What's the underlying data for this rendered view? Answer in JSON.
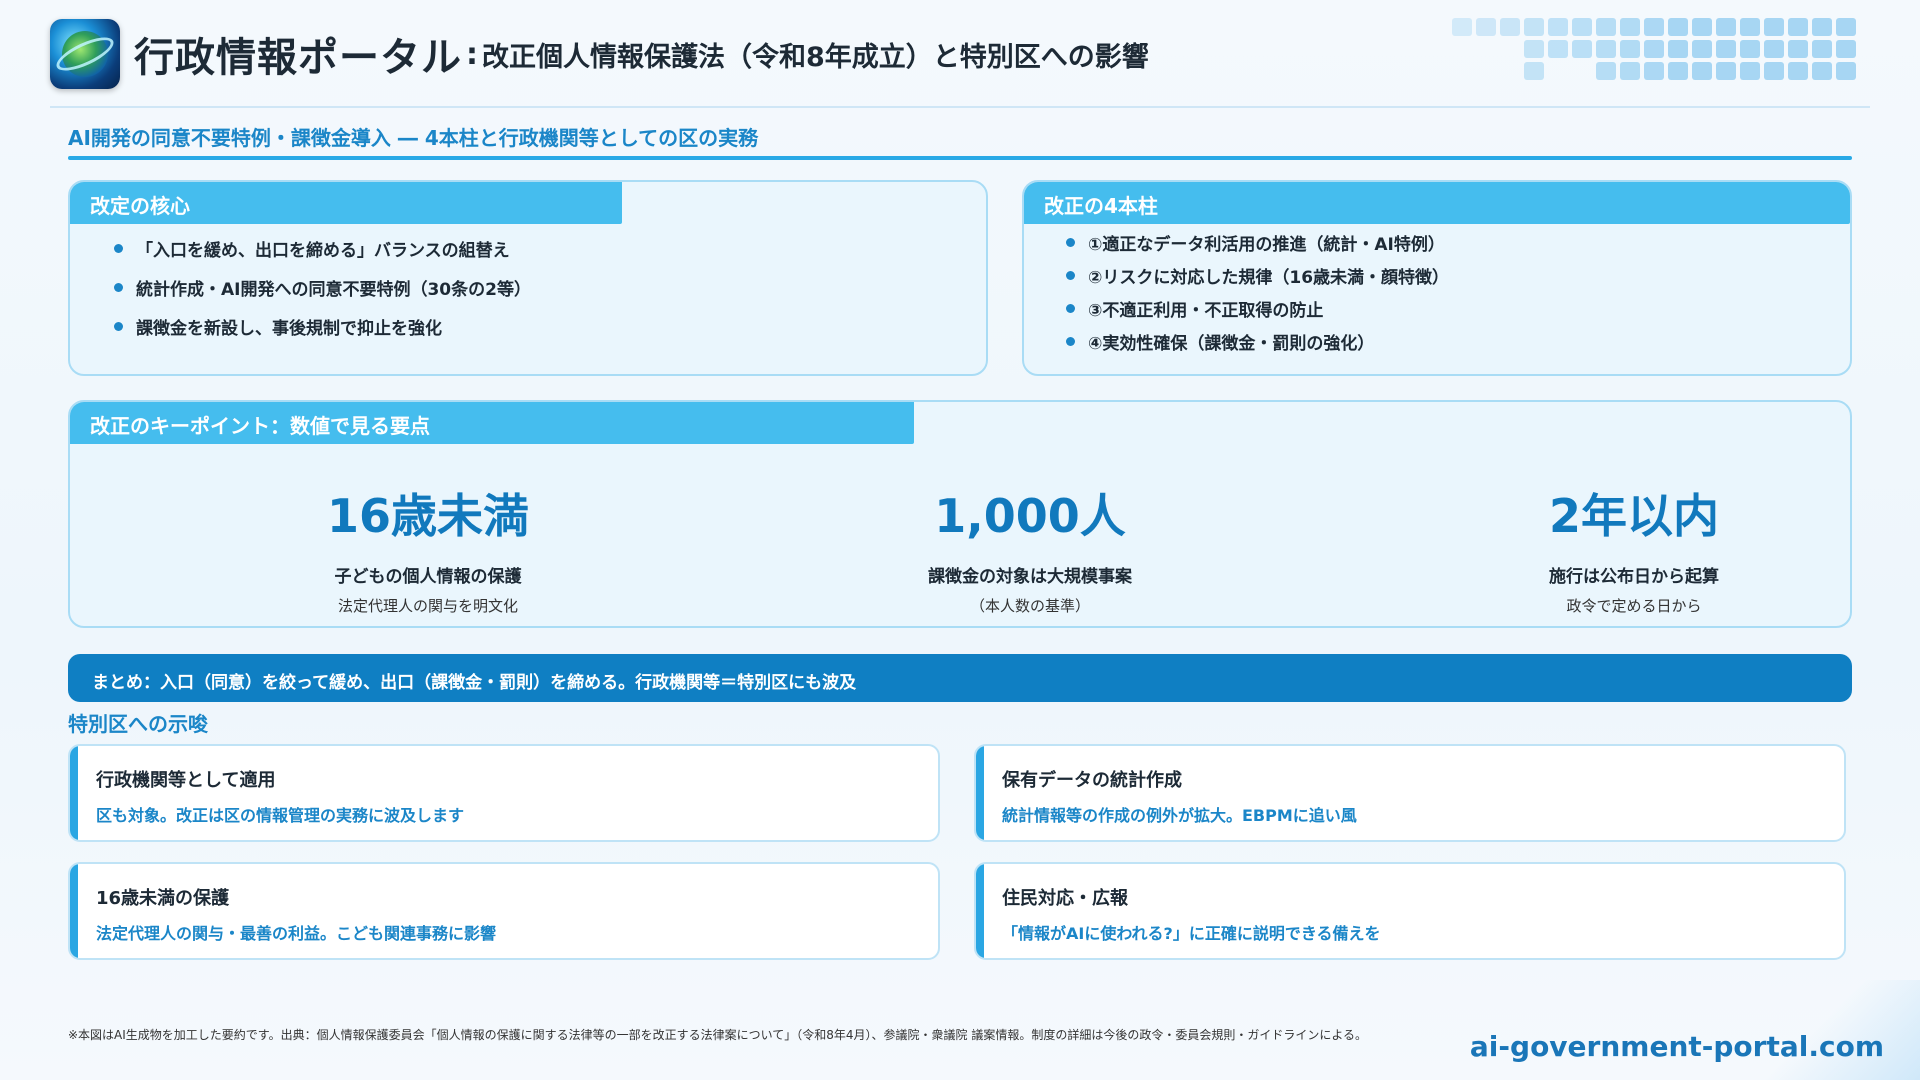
{
  "header": {
    "title": "行政情報ポータル",
    "separator": ":",
    "subtitle": "改正個人情報保護法（令和8年成立）と特別区への影響"
  },
  "subheading": "AI開発の同意不要特例・課徴金導入 ― 4本柱と行政機関等としての区の実務",
  "core": {
    "title": "改定の核心",
    "items": [
      "「入口を緩め、出口を締める」バランスの組替え",
      "統計作成・AI開発への同意不要特例（30条の2等）",
      "課徴金を新設し、事後規制で抑止を強化"
    ]
  },
  "pillars": {
    "title": "改正の4本柱",
    "items": [
      "①適正なデータ利活用の推進（統計・AI特例）",
      "②リスクに対応した規律（16歳未満・顔特徴）",
      "③不適正利用・不正取得の防止",
      "④実効性確保（課徴金・罰則の強化）"
    ]
  },
  "keypoints": {
    "title": "改正のキーポイント：数値で見る要点",
    "metrics": [
      {
        "value": "16歳未満",
        "label": "子どもの個人情報の保護",
        "note": "法定代理人の関与を明文化"
      },
      {
        "value": "1,000人",
        "label": "課徴金の対象は大規模事案",
        "note": "（本人数の基準）"
      },
      {
        "value": "2年以内",
        "label": "施行は公布日から起算",
        "note": "政令で定める日から"
      }
    ]
  },
  "summary": "まとめ：入口（同意）を絞って緩め、出口（課徴金・罰則）を締める。行政機関等＝特別区にも波及",
  "implications": {
    "title": "特別区への示唆",
    "items": [
      {
        "heading": "行政機関等として適用",
        "body": "区も対象。改正は区の情報管理の実務に波及します"
      },
      {
        "heading": "保有データの統計作成",
        "body": "統計情報等の作成の例外が拡大。EBPMに追い風"
      },
      {
        "heading": "16歳未満の保護",
        "body": "法定代理人の関与・最善の利益。こども関連事務に影響"
      },
      {
        "heading": "住民対応・広報",
        "body": "「情報がAIに使われる?」に正確に説明できる備えを"
      }
    ]
  },
  "footnote": "※本図はAI生成物を加工した要約です。出典：個人情報保護委員会「個人情報の保護に関する法律等の一部を改正する法律案について」（令和8年4月）、参議院・衆議院 議案情報。制度の詳細は今後の政令・委員会規則・ガイドラインによる。",
  "site": "ai-government-portal.com",
  "colors": {
    "accent": "#1b86c8",
    "tab": "#45bdee",
    "summary": "#0f7fc3",
    "value": "#1179bd"
  },
  "icons": {
    "logo": "globe-logo-icon"
  }
}
